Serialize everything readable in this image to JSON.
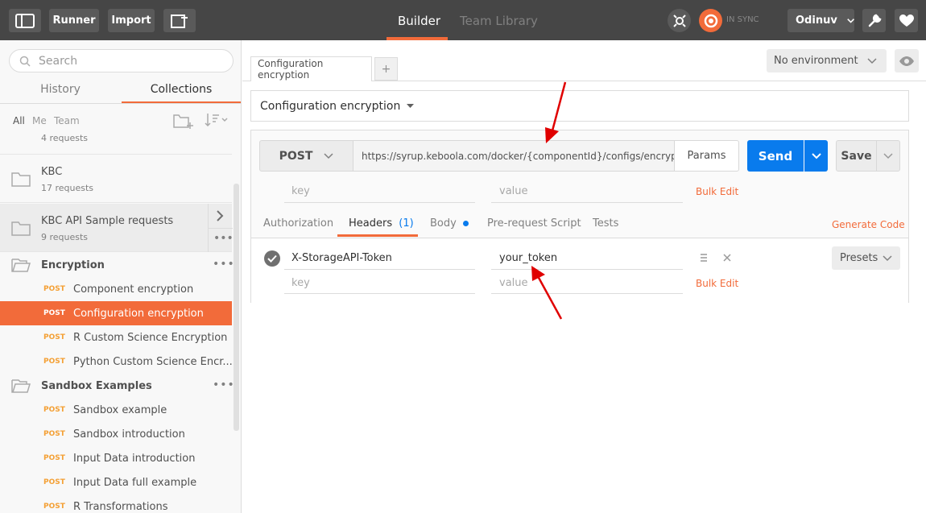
{
  "topbar": {
    "runner_label": "Runner",
    "import_label": "Import",
    "builder_tab": "Builder",
    "team_library_tab": "Team Library",
    "sync_status": "IN SYNC",
    "user_name": "Odinuv"
  },
  "sidebar": {
    "search_placeholder": "Search",
    "tabs": [
      "History",
      "Collections"
    ],
    "active_tab": "Collections",
    "filters": [
      "All",
      "Me",
      "Team"
    ],
    "partial_folder_requests": "4 requests",
    "folders": [
      {
        "name": "KBC",
        "requests": "17 requests"
      },
      {
        "name": "KBC API Sample requests",
        "requests": "9 requests"
      }
    ],
    "encryption": {
      "name": "Encryption",
      "items": [
        {
          "method": "POST",
          "name": "Component encryption"
        },
        {
          "method": "POST",
          "name": "Configuration encryption"
        },
        {
          "method": "POST",
          "name": "R Custom Science Encryption"
        },
        {
          "method": "POST",
          "name": "Python Custom Science Encr..."
        }
      ]
    },
    "sandbox": {
      "name": "Sandbox Examples",
      "items": [
        {
          "method": "POST",
          "name": "Sandbox example"
        },
        {
          "method": "POST",
          "name": "Sandbox introduction"
        },
        {
          "method": "POST",
          "name": "Input Data introduction"
        },
        {
          "method": "POST",
          "name": "Input Data full example"
        },
        {
          "method": "POST",
          "name": "R Transformations"
        }
      ]
    }
  },
  "main": {
    "request_tab": "Configuration encryption",
    "add_tab": "+",
    "environment": "No environment",
    "request_name": "Configuration encryption",
    "method": "POST",
    "url": "https://syrup.keboola.com/docker/{componentId}/configs/encrypt",
    "params_label": "Params",
    "send_label": "Send",
    "save_label": "Save",
    "url_params": {
      "key_placeholder": "key",
      "value_placeholder": "value",
      "bulk_edit": "Bulk Edit"
    },
    "sub_tabs": {
      "authorization": "Authorization",
      "headers": "Headers",
      "headers_count": "(1)",
      "body": "Body",
      "pre_request": "Pre-request Script",
      "tests": "Tests"
    },
    "generate_code": "Generate Code",
    "headers": [
      {
        "key": "X-StorageAPI-Token",
        "value": "your_token"
      }
    ],
    "new_header": {
      "key_placeholder": "key",
      "value_placeholder": "value"
    },
    "bulk_edit": "Bulk Edit",
    "presets_label": "Presets"
  },
  "colors": {
    "accent": "#f26b3a",
    "send_blue": "#097bed",
    "method_post": "#f4a035",
    "annotation_arrow": "#e00000"
  }
}
